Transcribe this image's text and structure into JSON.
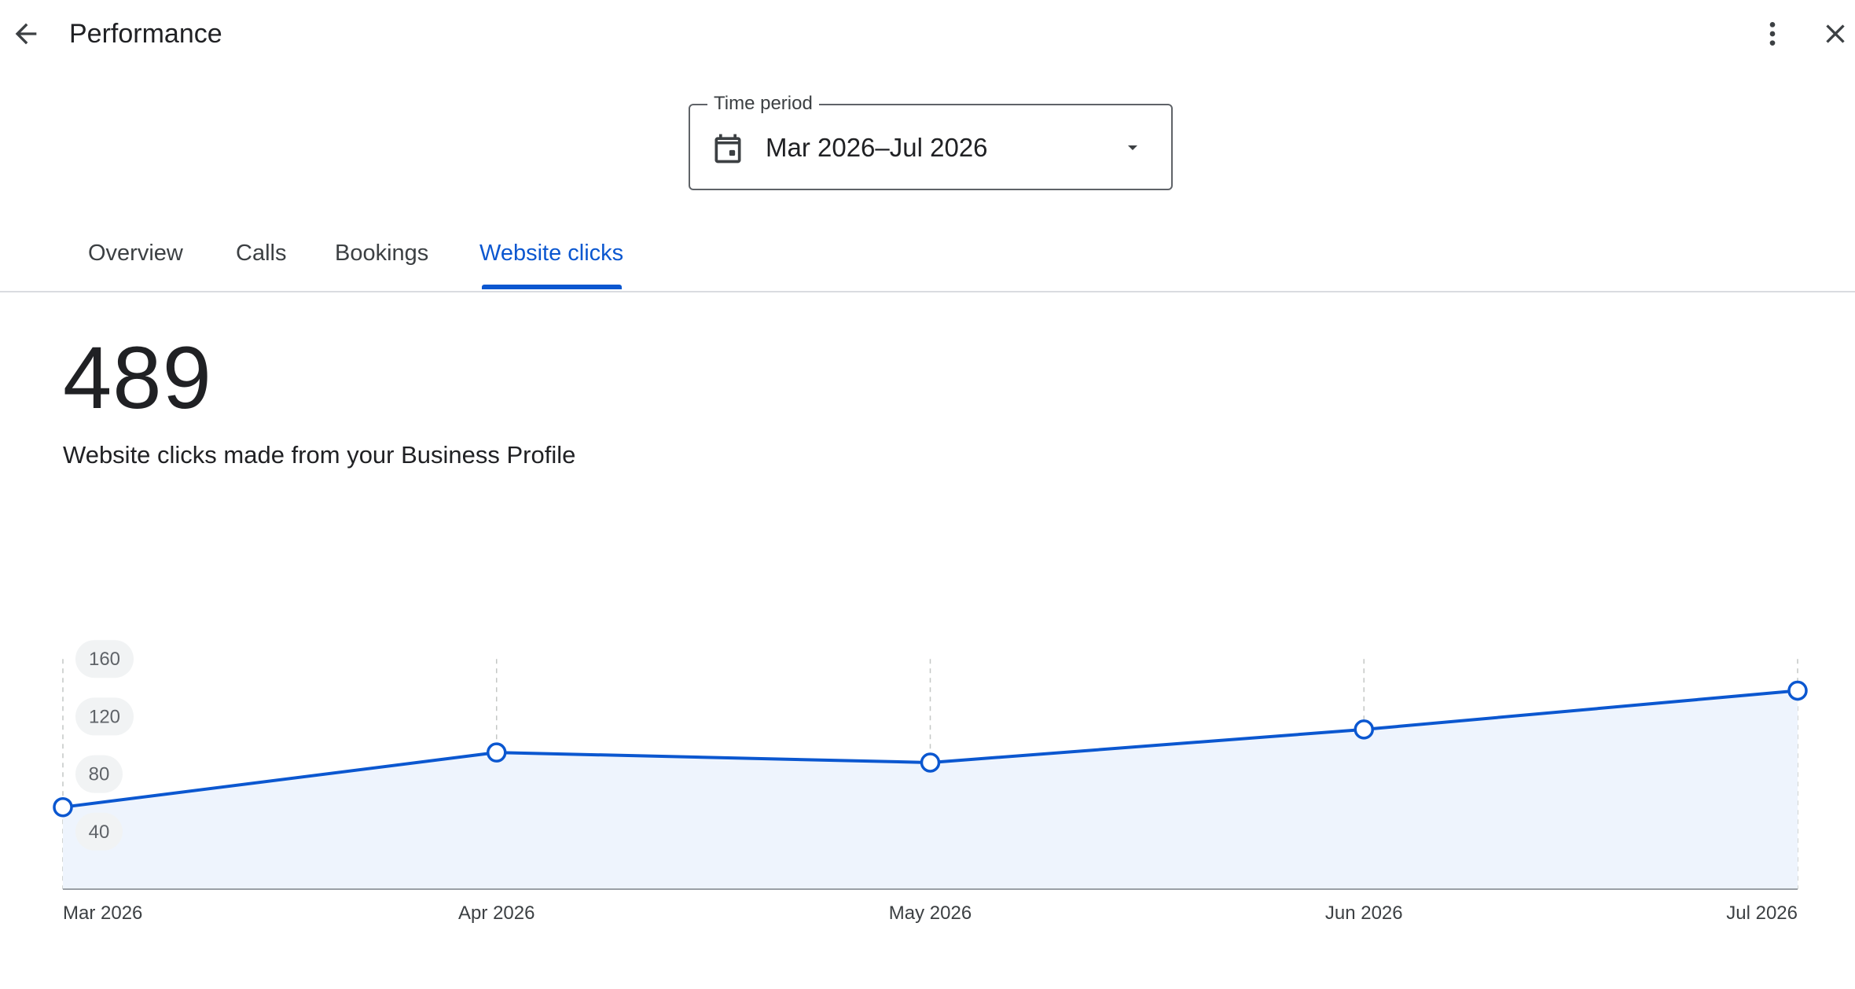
{
  "header": {
    "title": "Performance",
    "back_icon": "arrow-back-icon",
    "more_icon": "more-vert-icon",
    "close_icon": "close-icon"
  },
  "time_period": {
    "label": "Time period",
    "value": "Mar 2026–Jul 2026",
    "icon": "calendar-icon"
  },
  "tabs": [
    {
      "label": "Overview",
      "active": false
    },
    {
      "label": "Calls",
      "active": false
    },
    {
      "label": "Bookings",
      "active": false
    },
    {
      "label": "Website clicks",
      "active": true
    }
  ],
  "metric": {
    "total": "489",
    "description": "Website clicks made from your Business Profile"
  },
  "colors": {
    "accent": "#0b57d0",
    "area_fill": "#eef4fd",
    "grid": "#c4c7c5",
    "tick_pill": "#f1f3f4"
  },
  "chart_data": {
    "type": "area",
    "categories": [
      "Mar 2026",
      "Apr 2026",
      "May 2026",
      "Jun 2026",
      "Jul 2026"
    ],
    "series": [
      {
        "values": [
          57,
          95,
          88,
          111,
          138
        ]
      }
    ],
    "y_ticks": [
      40,
      80,
      120,
      160
    ],
    "ylim": [
      0,
      160
    ],
    "grid": "vertical-dashed",
    "markers": "hollow-circle"
  }
}
